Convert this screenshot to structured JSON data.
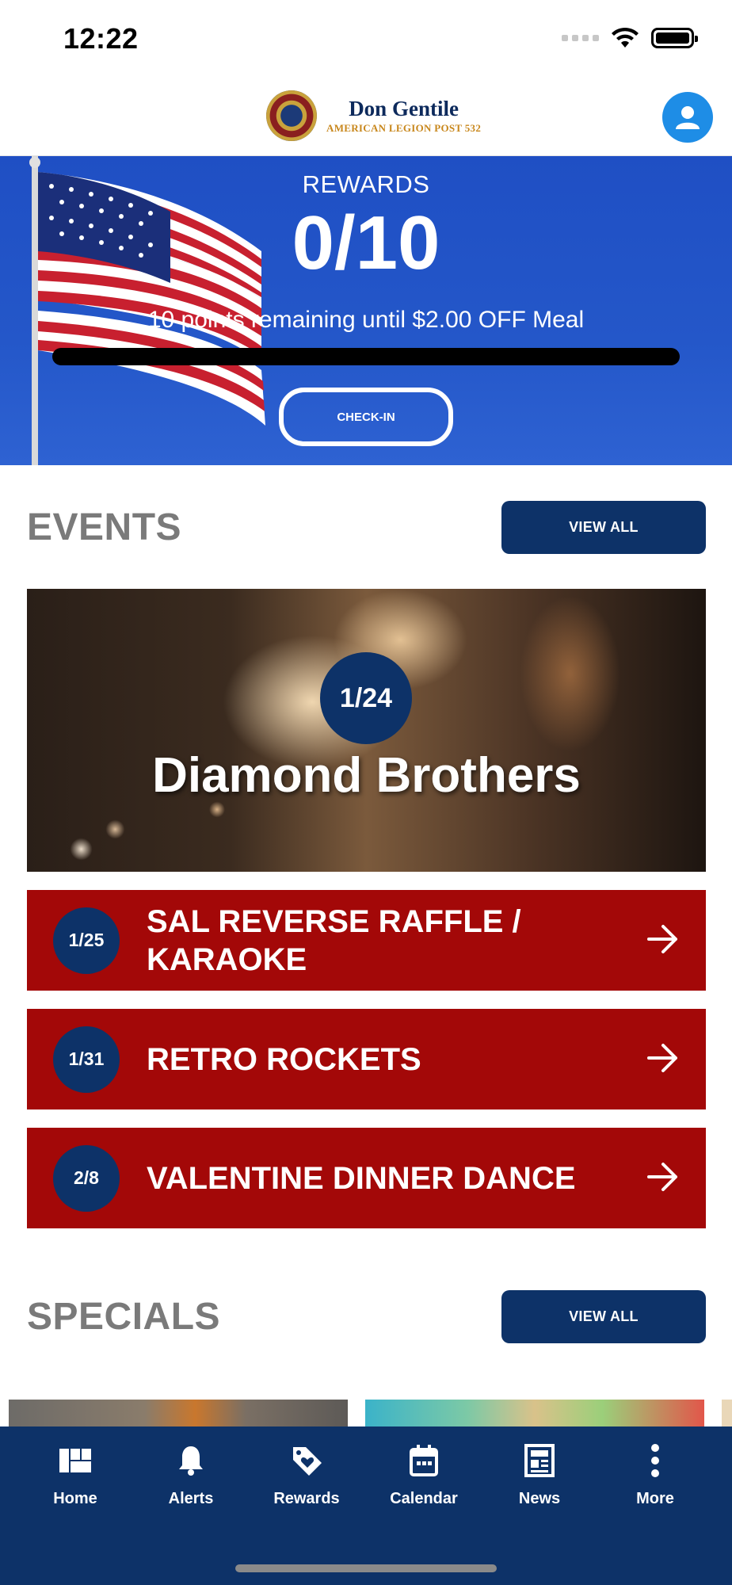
{
  "status_bar": {
    "time": "12:22"
  },
  "header": {
    "brand_title": "Don Gentile",
    "brand_subtitle": "AMERICAN LEGION POST 532"
  },
  "rewards": {
    "label": "REWARDS",
    "count": "0/10",
    "remaining_text": "10 points remaining until $2.00 OFF Meal",
    "progress_fraction": 0,
    "checkin_label": "CHECK-IN"
  },
  "events": {
    "title": "EVENTS",
    "view_all_label": "VIEW ALL",
    "featured": {
      "date": "1/24",
      "name": "Diamond Brothers"
    },
    "list": [
      {
        "date": "1/25",
        "name": "SAL REVERSE RAFFLE / KARAOKE"
      },
      {
        "date": "1/31",
        "name": "RETRO ROCKETS"
      },
      {
        "date": "2/8",
        "name": "VALENTINE DINNER DANCE"
      }
    ]
  },
  "specials": {
    "title": "SPECIALS",
    "view_all_label": "VIEW ALL"
  },
  "nav": {
    "items": [
      {
        "label": "Home",
        "icon": "home-grid-icon"
      },
      {
        "label": "Alerts",
        "icon": "bell-icon"
      },
      {
        "label": "Rewards",
        "icon": "tag-heart-icon"
      },
      {
        "label": "Calendar",
        "icon": "calendar-icon"
      },
      {
        "label": "News",
        "icon": "newspaper-icon"
      },
      {
        "label": "More",
        "icon": "more-vertical-icon"
      }
    ]
  },
  "colors": {
    "navy": "#0d3268",
    "event_red": "#a30808",
    "rewards_blue": "#2457c9",
    "profile_blue": "#1e8de6",
    "section_gray": "#7a7a7a"
  }
}
